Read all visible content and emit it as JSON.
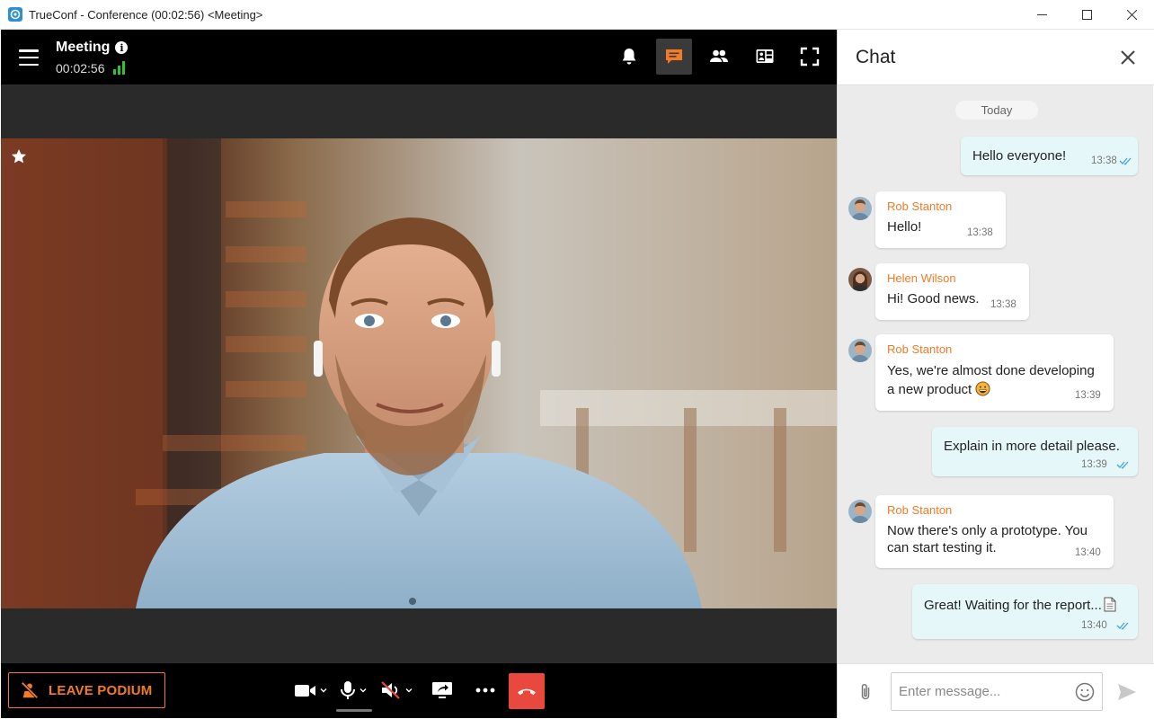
{
  "window": {
    "title": "TrueConf - Conference (00:02:56) <Meeting>",
    "controls": [
      "minimize-icon",
      "maximize-icon",
      "close-icon"
    ]
  },
  "conference": {
    "title": "Meeting",
    "duration": "00:02:56",
    "signal_bars": 3,
    "top_icons": [
      "bell-icon",
      "chat-icon",
      "participants-icon",
      "layout-icon",
      "fullscreen-icon"
    ],
    "active_top_icon": "chat-icon",
    "leave_podium_label": "LEAVE PODIUM",
    "controls": [
      "camera-icon",
      "microphone-icon",
      "speaker-muted-icon",
      "share-screen-icon",
      "more-icon",
      "hangup-icon"
    ],
    "colors": {
      "accent": "#f37b27",
      "hangup": "#e8483d",
      "signal": "#31c42f"
    }
  },
  "chat": {
    "title": "Chat",
    "date_label": "Today",
    "messages": [
      {
        "direction": "out",
        "text": "Hello everyone!",
        "time": "13:38"
      },
      {
        "direction": "in",
        "author": "Rob Stanton",
        "text": "Hello!",
        "time": "13:38"
      },
      {
        "direction": "in",
        "author": "Helen Wilson",
        "text": "Hi! Good news.",
        "time": "13:38"
      },
      {
        "direction": "in",
        "author": "Rob Stanton",
        "text_line1": "Yes, we're almost done developing",
        "text_line2": "a new product",
        "time": "13:39"
      },
      {
        "direction": "out",
        "text": "Explain in more detail please.",
        "time": "13:39"
      },
      {
        "direction": "in",
        "author": "Rob Stanton",
        "text_line1": "Now there's only a prototype. You",
        "text_line2": "can start testing it.",
        "time": "13:40"
      },
      {
        "direction": "out",
        "text": "Great! Waiting for the report...",
        "time": "13:40"
      }
    ],
    "input_placeholder": "Enter message...",
    "colors": {
      "outgoing_bubble": "#e5f7f8",
      "incoming_bubble": "#ffffff",
      "author": "#f37b27",
      "read_checks": "#4aa3df"
    }
  }
}
